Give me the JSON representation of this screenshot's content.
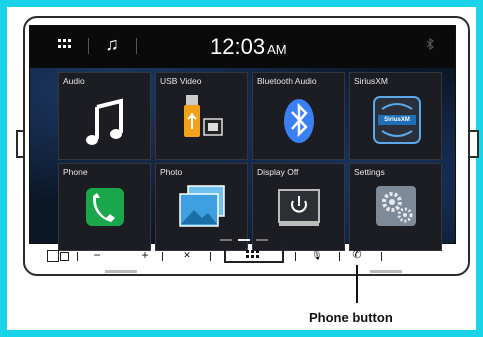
{
  "status_bar": {
    "time": "12:03",
    "ampm": "AM"
  },
  "tiles": [
    {
      "label": "Audio",
      "icon": "music-note-icon"
    },
    {
      "label": "USB Video",
      "icon": "usb-video-icon"
    },
    {
      "label": "Bluetooth Audio",
      "icon": "bluetooth-icon"
    },
    {
      "label": "SiriusXM",
      "icon": "siriusxm-icon",
      "badge_text": "SiriusXM"
    },
    {
      "label": "Phone",
      "icon": "phone-icon"
    },
    {
      "label": "Photo",
      "icon": "photo-icon"
    },
    {
      "label": "Display Off",
      "icon": "power-icon"
    },
    {
      "label": "Settings",
      "icon": "gears-icon"
    }
  ],
  "bottom_controls": {
    "volume_down": "−",
    "volume_up": "+",
    "mute": "✕",
    "mic": "🎙",
    "phone": "✆"
  },
  "callout": {
    "text": "Phone button"
  },
  "colors": {
    "frame": "#19d3e8",
    "screen": "#0b1626",
    "tile": "#1c1d22",
    "bluetooth": "#3b7ff5",
    "phone_green": "#1aa64a"
  }
}
